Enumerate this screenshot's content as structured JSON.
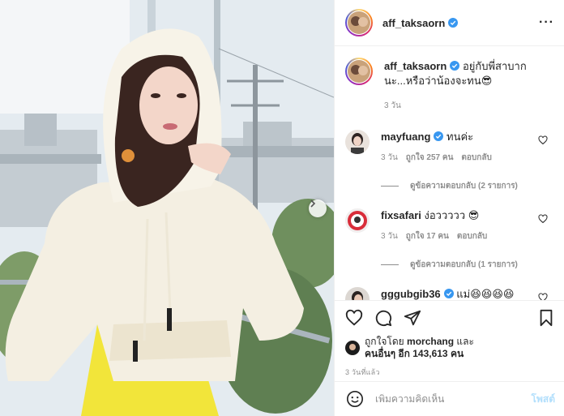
{
  "post": {
    "author": "aff_taksaorn",
    "caption": "อยู่กับพี่สาบากนะ...หรือว่าน้องจะทน😎",
    "caption_time": "3 วัน",
    "posted_ago": "3 วันที่แล้ว"
  },
  "comments": [
    {
      "user": "mayfuang",
      "verified": true,
      "text": "ทนค่ะ",
      "time": "3 วัน",
      "likes": "ถูกใจ 257 คน",
      "reply_label": "ตอบกลับ",
      "view_replies": "ดูข้อความตอบกลับ (2 รายการ)"
    },
    {
      "user": "fixsafari",
      "verified": false,
      "text": "ง่อววววว 😎",
      "time": "3 วัน",
      "likes": "ถูกใจ 17 คน",
      "reply_label": "ตอบกลับ",
      "view_replies": "ดูข้อความตอบกลับ (1 รายการ)"
    },
    {
      "user": "gggubgib36",
      "verified": true,
      "text": "แม่😆😆😆😆",
      "time": "",
      "likes": "",
      "reply_label": "",
      "view_replies": ""
    }
  ],
  "likes_summary": {
    "prefix": "ถูกใจโดย",
    "user": "morchang",
    "and": "และ",
    "others": "คนอื่นๆ อีก 143,613 คน"
  },
  "add_comment": {
    "placeholder": "เพิ่มความคิดเห็น",
    "post_label": "โพสต์"
  },
  "colors": {
    "verified": "#3897f0",
    "post_disabled": "#b2dffc",
    "muted": "#8e8e8e"
  }
}
